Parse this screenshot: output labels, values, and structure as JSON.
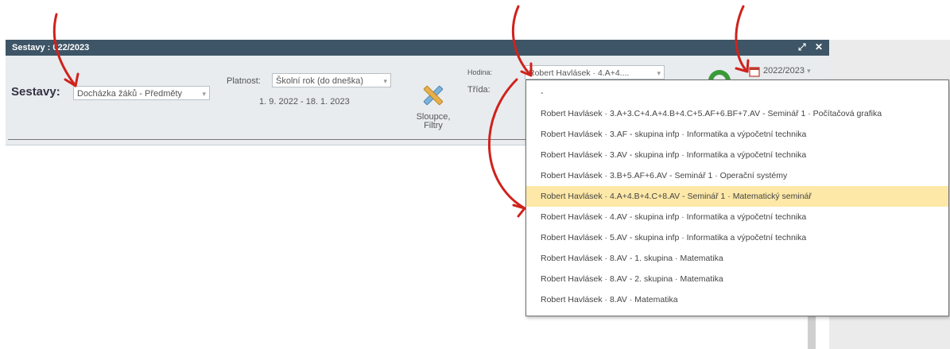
{
  "window": {
    "title": "Sestavy : 022/2023",
    "expand_glyph": "⤢",
    "close_glyph": "✕"
  },
  "toolbar": {
    "sestavy_label": "Sestavy:",
    "sestavy_value": "Docházka žáků - Předměty",
    "platnost_label": "Platnost:",
    "platnost_value": "Školní rok (do dneška)",
    "date_range": "1. 9. 2022 - 18. 1. 2023",
    "columns_label_1": "Sloupce,",
    "columns_label_2": "Filtry",
    "hodina_label": "Hodina:",
    "trida_label": "Třída:",
    "hodina_value": "Robert Havlásek · 4.A+4....",
    "year_value": "2022/2023",
    "combo_arrow": "▾"
  },
  "dropdown": {
    "options": [
      "-",
      "Robert Havlásek · 3.A+3.C+4.A+4.B+4.C+5.AF+6.BF+7.AV - Seminář 1 · Počítačová grafika",
      "Robert Havlásek · 3.AF - skupina infp · Informatika a výpočetní technika",
      "Robert Havlásek · 3.AV - skupina infp · Informatika a výpočetní technika",
      "Robert Havlásek · 3.B+5.AF+6.AV - Seminář 1 · Operační systémy",
      "Robert Havlásek · 4.A+4.B+4.C+8.AV - Seminář 1 · Matematický seminář",
      "Robert Havlásek · 4.AV - skupina infp · Informatika a výpočetní technika",
      "Robert Havlásek · 5.AV - skupina infp · Informatika a výpočetní technika",
      "Robert Havlásek · 8.AV - 1. skupina · Matematika",
      "Robert Havlásek · 8.AV - 2. skupina · Matematika",
      "Robert Havlásek · 8.AV · Matematika"
    ],
    "selected_index": 5
  },
  "colors": {
    "titlebar": "#3d5566",
    "toolbar_bg": "#e8ecef",
    "selected_row": "#fde8a8",
    "annotation_arrow": "#d0221c"
  },
  "icons": {
    "tool": "pencil-ruler-icon",
    "calendar": "calendar-icon",
    "refresh": "green-refresh-icon"
  }
}
